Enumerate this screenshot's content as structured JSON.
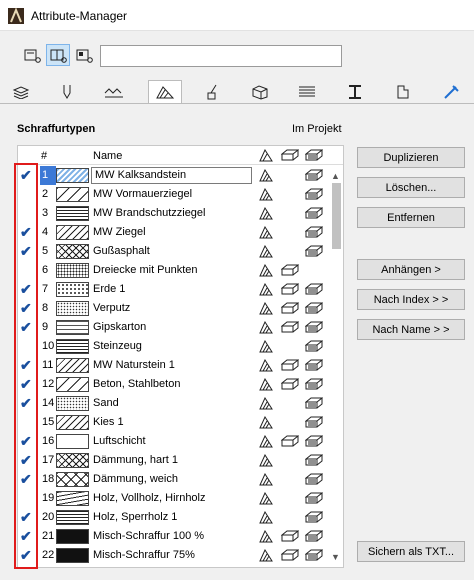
{
  "window": {
    "title": "Attribute-Manager",
    "app_icon": "archicad-icon"
  },
  "view_buttons": [
    {
      "icon": "list-view-icon",
      "active": false
    },
    {
      "icon": "split-view-icon",
      "active": true
    },
    {
      "icon": "preview-view-icon",
      "active": false
    }
  ],
  "search": {
    "value": "",
    "placeholder": ""
  },
  "tabs": [
    {
      "icon": "layers-icon"
    },
    {
      "icon": "pen-icon"
    },
    {
      "icon": "line-types-icon"
    },
    {
      "icon": "fill-types-icon"
    },
    {
      "icon": "surfaces-icon"
    },
    {
      "icon": "building-materials-icon"
    },
    {
      "icon": "composites-icon"
    },
    {
      "icon": "profiles-icon"
    },
    {
      "icon": "zone-categories-icon"
    },
    {
      "icon": "markup-icon"
    }
  ],
  "section": {
    "title": "Schraffurtypen",
    "in_project": "Im Projekt"
  },
  "list": {
    "columns": {
      "num": "#",
      "name": "Name"
    },
    "rows": [
      {
        "checked": true,
        "num": "1",
        "name": "MW Kalksandstein",
        "pattern": "hatch-blue",
        "icons": [
          1,
          0,
          1
        ]
      },
      {
        "checked": false,
        "num": "2",
        "name": "MW Vormauerziegel",
        "pattern": "diag-wide",
        "icons": [
          1,
          0,
          1
        ]
      },
      {
        "checked": false,
        "num": "3",
        "name": "MW Brandschutzziegel",
        "pattern": "grid-dense",
        "icons": [
          1,
          0,
          1
        ]
      },
      {
        "checked": true,
        "num": "4",
        "name": "MW Ziegel",
        "pattern": "diag",
        "icons": [
          1,
          0,
          1
        ]
      },
      {
        "checked": true,
        "num": "5",
        "name": "Gußasphalt",
        "pattern": "cross",
        "icons": [
          1,
          0,
          1
        ]
      },
      {
        "checked": false,
        "num": "6",
        "name": "Dreiecke mit Punkten",
        "pattern": "dots-tri",
        "icons": [
          1,
          1,
          0
        ]
      },
      {
        "checked": true,
        "num": "7",
        "name": "Erde 1",
        "pattern": "dots",
        "icons": [
          1,
          1,
          1
        ]
      },
      {
        "checked": true,
        "num": "8",
        "name": "Verputz",
        "pattern": "dots-fine",
        "icons": [
          1,
          1,
          1
        ]
      },
      {
        "checked": true,
        "num": "9",
        "name": "Gipskarton",
        "pattern": "grid",
        "icons": [
          1,
          1,
          1
        ]
      },
      {
        "checked": false,
        "num": "10",
        "name": "Steinzeug",
        "pattern": "grid-dense",
        "icons": [
          1,
          0,
          1
        ]
      },
      {
        "checked": true,
        "num": "11",
        "name": "MW Naturstein 1",
        "pattern": "diag",
        "icons": [
          1,
          1,
          1
        ]
      },
      {
        "checked": true,
        "num": "12",
        "name": "Beton, Stahlbeton",
        "pattern": "diag-wide",
        "icons": [
          1,
          1,
          1
        ]
      },
      {
        "checked": true,
        "num": "14",
        "name": "Sand",
        "pattern": "dots-fine",
        "icons": [
          1,
          0,
          1
        ]
      },
      {
        "checked": false,
        "num": "15",
        "name": "Kies 1",
        "pattern": "diag",
        "icons": [
          1,
          0,
          1
        ]
      },
      {
        "checked": true,
        "num": "16",
        "name": "Luftschicht",
        "pattern": "empty",
        "icons": [
          1,
          1,
          1
        ]
      },
      {
        "checked": true,
        "num": "17",
        "name": "Dämmung, hart 1",
        "pattern": "cross",
        "icons": [
          1,
          0,
          1
        ]
      },
      {
        "checked": true,
        "num": "18",
        "name": "Dämmung, weich",
        "pattern": "cross-wide",
        "icons": [
          1,
          0,
          1
        ]
      },
      {
        "checked": false,
        "num": "19",
        "name": "Holz, Vollholz, Hirnholz",
        "pattern": "wave",
        "icons": [
          1,
          0,
          1
        ]
      },
      {
        "checked": true,
        "num": "20",
        "name": "Holz, Sperrholz 1",
        "pattern": "lines",
        "icons": [
          1,
          0,
          1
        ]
      },
      {
        "checked": true,
        "num": "21",
        "name": "Misch-Schraffur 100 %",
        "pattern": "solid",
        "icons": [
          1,
          1,
          1
        ]
      },
      {
        "checked": true,
        "num": "22",
        "name": "Misch-Schraffur 75%",
        "pattern": "solid",
        "icons": [
          1,
          1,
          1
        ]
      }
    ]
  },
  "buttons": {
    "duplicate": "Duplizieren",
    "delete": "Löschen...",
    "remove": "Entfernen",
    "append": "Anhängen >",
    "by_index": "Nach Index > >",
    "by_name": "Nach Name > >",
    "save_txt": "Sichern als TXT..."
  },
  "colors": {
    "selection": "#3c79d6",
    "checkmark": "#1a4f9e",
    "highlight_box": "#e01b1b"
  }
}
